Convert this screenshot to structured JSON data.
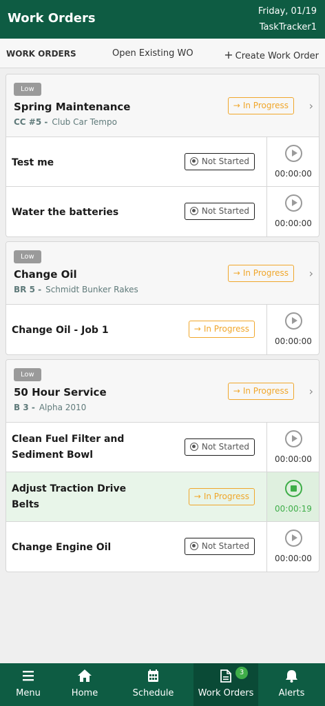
{
  "header": {
    "title": "Work Orders",
    "date": "Friday, 01/19",
    "account": "TaskTracker1"
  },
  "tabs": {
    "work_orders": "WORK ORDERS",
    "open_existing": "Open Existing WO",
    "create": "Create Work Order"
  },
  "work_orders": [
    {
      "priority": "Low",
      "title": "Spring Maintenance",
      "code": "CC #5 -",
      "equipment": "Club Car Tempo",
      "status": "In Progress",
      "tasks": [
        {
          "name": "Test me",
          "status": "Not Started",
          "time": "00:00:00"
        },
        {
          "name": "Water the batteries",
          "status": "Not Started",
          "time": "00:00:00"
        }
      ]
    },
    {
      "priority": "Low",
      "title": "Change Oil",
      "code": "BR 5 -",
      "equipment": "Schmidt Bunker Rakes",
      "status": "In Progress",
      "tasks": [
        {
          "name": "Change Oil - Job 1",
          "status": "In Progress",
          "time": "00:00:00"
        }
      ]
    },
    {
      "priority": "Low",
      "title": "50 Hour Service",
      "code": "B 3 -",
      "equipment": "Alpha 2010",
      "status": "In Progress",
      "tasks": [
        {
          "name": "Clean Fuel Filter and Sediment Bowl",
          "status": "Not Started",
          "time": "00:00:00"
        },
        {
          "name": "Adjust Traction Drive Belts",
          "status": "In Progress",
          "time": "00:00:19"
        },
        {
          "name": "Change Engine Oil",
          "status": "Not Started",
          "time": "00:00:00"
        }
      ]
    }
  ],
  "nav": {
    "menu": "Menu",
    "home": "Home",
    "schedule": "Schedule",
    "work_orders": "Work Orders",
    "alerts": "Alerts",
    "badge": "3"
  },
  "colors": {
    "brand": "#0e5c43",
    "in_progress": "#f0a62a",
    "active": "#3fae49",
    "priority": "#9a9a9a"
  }
}
